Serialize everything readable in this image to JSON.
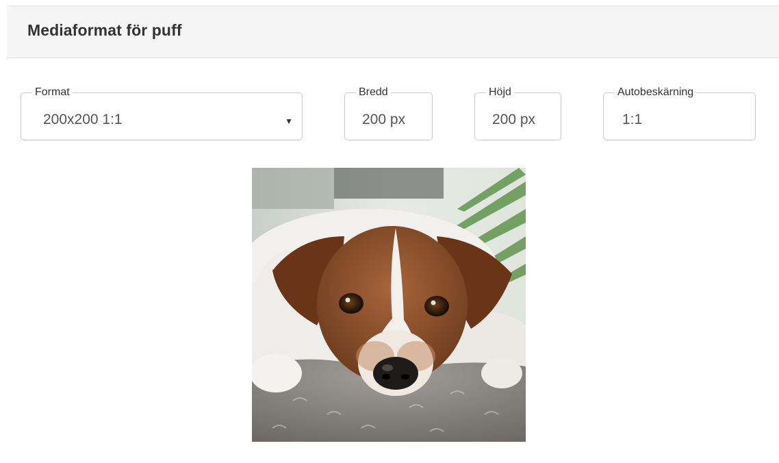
{
  "panel": {
    "title": "Mediaformat för puff"
  },
  "fields": {
    "format": {
      "label": "Format",
      "value": "200x200 1:1",
      "caret_icon": "caret-down-icon"
    },
    "bredd": {
      "label": "Bredd",
      "value": "200 px"
    },
    "hojd": {
      "label": "Höjd",
      "value": "200 px"
    },
    "autobeskarning": {
      "label": "Autobeskärning",
      "value": "1:1"
    }
  },
  "preview": {
    "subject": "dog-photo"
  },
  "colors": {
    "header_bg": "#f5f5f5",
    "border": "#c9c9c9",
    "title": "#333333",
    "value_text": "#555555"
  }
}
